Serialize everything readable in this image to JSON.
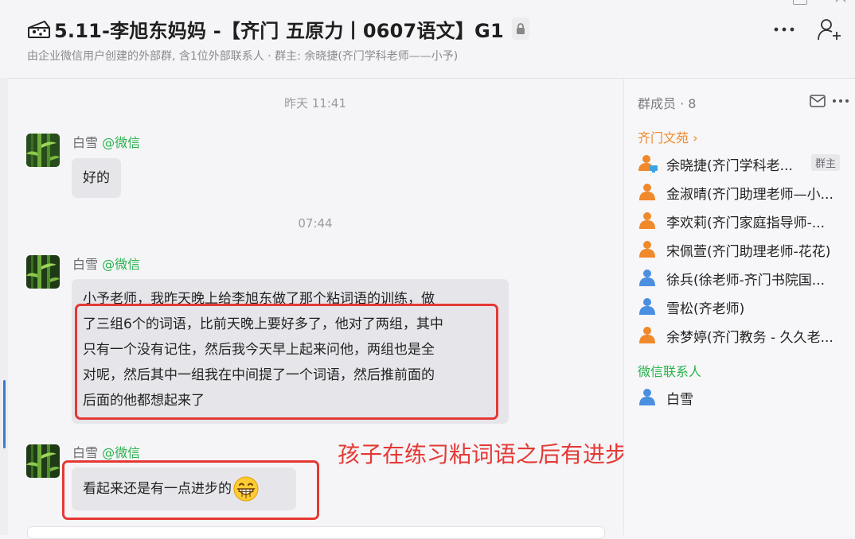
{
  "header": {
    "title": "5.11-李旭东妈妈 -【齐门 五原力丨0607语文】G1",
    "subtitle": "由企业微信用户创建的外部群, 含1位外部联系人 · 群主: 余晓捷(齐门学科老师——小予)"
  },
  "chat": {
    "timestamps": [
      "昨天 11:41",
      "07:44"
    ],
    "messages": [
      {
        "sender": "白雪",
        "source": "@微信",
        "text": "好的"
      },
      {
        "sender": "白雪",
        "source": "@微信",
        "lines": [
          "小予老师，我昨天晚上给李旭东做了那个粘词语的训练，做",
          "了三组6个的词语，比前天晚上要好多了，他对了两组，其中",
          "只有一个没有记住，然后我今天早上起来问他，两组也是全",
          "对呢，然后其中一组我在中间提了一个词语，然后推前面的",
          "后面的他都想起来了"
        ]
      },
      {
        "sender": "白雪",
        "source": "@微信",
        "text": "看起来还是有一点进步的",
        "emoji": "grinning-face-icon"
      }
    ],
    "annotation": "孩子在练习粘词语之后有进步"
  },
  "sidebar": {
    "header": "群成员 · 8",
    "section_company": "齐门文苑 ›",
    "members": [
      {
        "name": "余晓捷(齐门学科老...",
        "badge": "群主",
        "icon": "orange"
      },
      {
        "name": "金淑晴(齐门助理老师—小...",
        "icon": "orange"
      },
      {
        "name": "李欢莉(齐门家庭指导师-...",
        "icon": "orange"
      },
      {
        "name": "宋佩萱(齐门助理老师-花花)",
        "icon": "orange"
      },
      {
        "name": "徐兵(徐老师-齐门书院国...",
        "icon": "blue"
      },
      {
        "name": "雪松(齐老师)",
        "icon": "blue"
      },
      {
        "name": "余梦婷(齐门教务 - 久久老...",
        "icon": "orange"
      }
    ],
    "section_wechat": "微信联系人",
    "wechat_members": [
      {
        "name": "白雪",
        "icon": "blue"
      }
    ]
  },
  "colors": {
    "accent_orange": "#f0892b",
    "wechat_green": "#29b24c",
    "annotation_red": "#e53935",
    "member_blue": "#4a8fe0"
  }
}
